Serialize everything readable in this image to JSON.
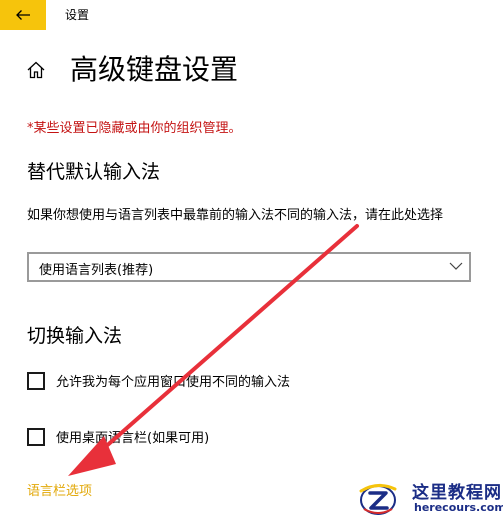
{
  "window": {
    "title": "设置"
  },
  "header": {
    "page_title": "高级键盘设置"
  },
  "notice": {
    "text": "*某些设置已隐藏或由你的组织管理。"
  },
  "override_input": {
    "heading": "替代默认输入法",
    "description": "如果你想使用与语言列表中最靠前的输入法不同的输入法，请在此处选择",
    "dropdown_value": "使用语言列表(推荐)"
  },
  "switch_input": {
    "heading": "切换输入法",
    "options": [
      {
        "label": "允许我为每个应用窗口使用不同的输入法",
        "checked": false
      },
      {
        "label": "使用桌面语言栏(如果可用)",
        "checked": false
      }
    ],
    "link": "语言栏选项"
  },
  "watermark": {
    "title": "这里教程网",
    "url": "herecours.com"
  },
  "colors": {
    "accent": "#f6c40c",
    "link": "#e2a808",
    "warning": "#c41313",
    "arrow": "#e8303a"
  },
  "icons": {
    "back": "arrow-left-icon",
    "home": "home-icon",
    "dropdown": "chevron-down-icon"
  }
}
